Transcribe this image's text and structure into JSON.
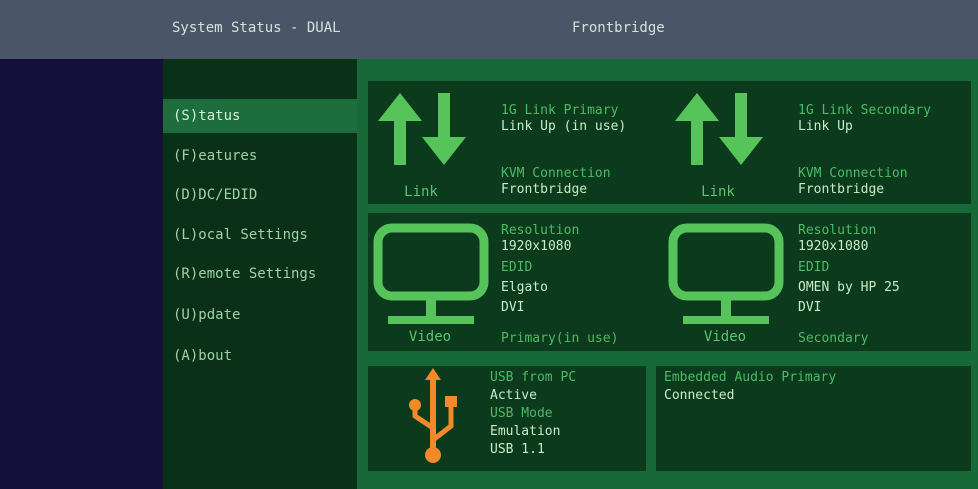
{
  "header": {
    "title": "System Status - DUAL",
    "source": "Frontbridge"
  },
  "sidebar": {
    "items": [
      {
        "label": "(S)tatus",
        "active": true
      },
      {
        "label": "(F)eatures"
      },
      {
        "label": "(D)DC/EDID"
      },
      {
        "label": "(L)ocal Settings"
      },
      {
        "label": "(R)emote Settings"
      },
      {
        "label": "(U)pdate"
      },
      {
        "label": "(A)bout"
      }
    ]
  },
  "link": {
    "primary": {
      "caption": "Link",
      "link_label": "1G Link Primary",
      "link_value": "Link Up (in use)",
      "kvm_label": "KVM Connection",
      "kvm_value": "Frontbridge",
      "icon": "link-arrows-icon"
    },
    "secondary": {
      "caption": "Link",
      "link_label": "1G Link Secondary",
      "link_value": "Link Up",
      "kvm_label": "KVM Connection",
      "kvm_value": "Frontbridge",
      "icon": "link-arrows-icon"
    }
  },
  "video": {
    "primary": {
      "caption": "Video",
      "resolution_label": "Resolution",
      "resolution_value": "1920x1080",
      "edid_label": "EDID",
      "edid_value": "Elgato",
      "interface": "DVI",
      "role": "Primary(in use)",
      "icon": "monitor-icon"
    },
    "secondary": {
      "caption": "Video",
      "resolution_label": "Resolution",
      "resolution_value": "1920x1080",
      "edid_label": "EDID",
      "edid_value": "OMEN by HP 25",
      "interface": "DVI",
      "role": "Secondary",
      "icon": "monitor-icon"
    }
  },
  "usb": {
    "label": "USB from PC",
    "state": "Active",
    "mode_label": "USB Mode",
    "mode_value": "Emulation",
    "version": "USB 1.1",
    "icon": "usb-icon"
  },
  "audio": {
    "label": "Embedded Audio Primary",
    "value": "Connected"
  },
  "colors": {
    "titlebar": "#4a5668",
    "left_band": "#14103c",
    "sidebar": "#0a3018",
    "sidebar_active": "#1d6e3c",
    "main": "#176a37",
    "panel": "#0b3a1c",
    "accent_green": "#56c45a",
    "usb_orange": "#f08a2a"
  }
}
